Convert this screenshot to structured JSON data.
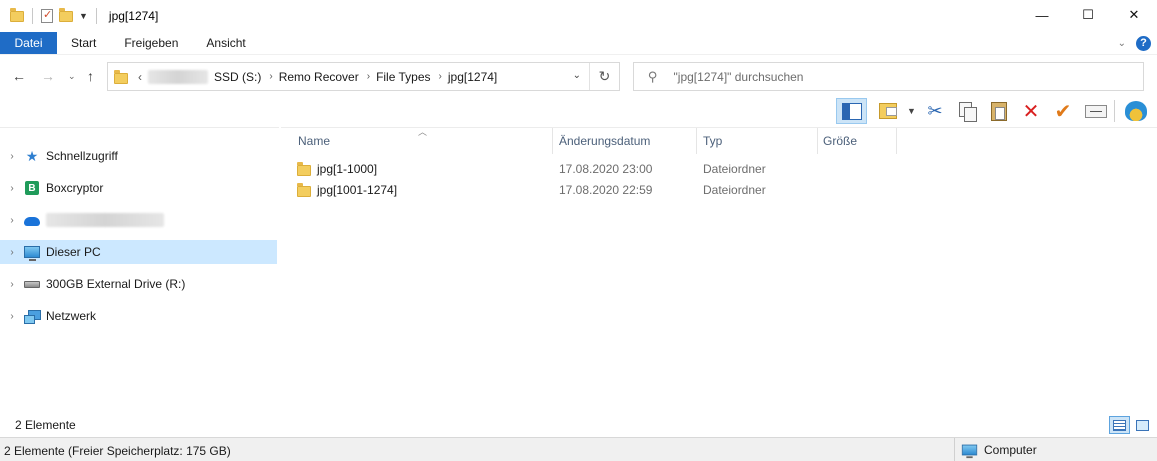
{
  "window": {
    "title": "jpg[1274]",
    "minimize": "—",
    "maximize": "☐",
    "close": "✕"
  },
  "ribbon": {
    "tabs": [
      {
        "label": "Datei"
      },
      {
        "label": "Start"
      },
      {
        "label": "Freigeben"
      },
      {
        "label": "Ansicht"
      }
    ],
    "help_icon": "?"
  },
  "address": {
    "prefix": "‹",
    "crumbs": [
      "SSD (S:)",
      "Remo Recover",
      "File Types",
      "jpg[1274]"
    ],
    "search_placeholder": "\"jpg[1274]\" durchsuchen"
  },
  "toolbar": {
    "icons": [
      "preview-pane-icon",
      "change-view-icon",
      "cut-icon",
      "copy-icon",
      "paste-icon",
      "delete-icon",
      "check-icon",
      "rename-icon",
      "shell-icon"
    ],
    "colors": {
      "delete": "#d92020",
      "check": "#e07a1a",
      "cut": "#2a66b2"
    }
  },
  "nav": {
    "items": [
      {
        "label": "Schnellzugriff",
        "icon": "star-icon"
      },
      {
        "label": "Boxcryptor",
        "icon": "boxcryptor-icon"
      },
      {
        "label": "",
        "icon": "onedrive-cloud-icon"
      },
      {
        "label": "Dieser PC",
        "icon": "computer-icon",
        "selected": true
      },
      {
        "label": "300GB External Drive (R:)",
        "icon": "drive-icon"
      },
      {
        "label": "Netzwerk",
        "icon": "network-icon"
      }
    ]
  },
  "files": {
    "columns": [
      "Name",
      "Änderungsdatum",
      "Typ",
      "Größe"
    ],
    "rows": [
      {
        "name": "jpg[1-1000]",
        "date": "17.08.2020 23:00",
        "type": "Dateiordner",
        "size": ""
      },
      {
        "name": "jpg[1001-1274]",
        "date": "17.08.2020 22:59",
        "type": "Dateiordner",
        "size": ""
      }
    ]
  },
  "status": {
    "item_count": "2 Elemente",
    "summary": "2 Elemente (Freier Speicherplatz: 175 GB)",
    "location": "Computer"
  },
  "colors": {
    "accent": "#1f6cc6",
    "selection": "#cce8ff",
    "folder": "#f3cd5e"
  }
}
